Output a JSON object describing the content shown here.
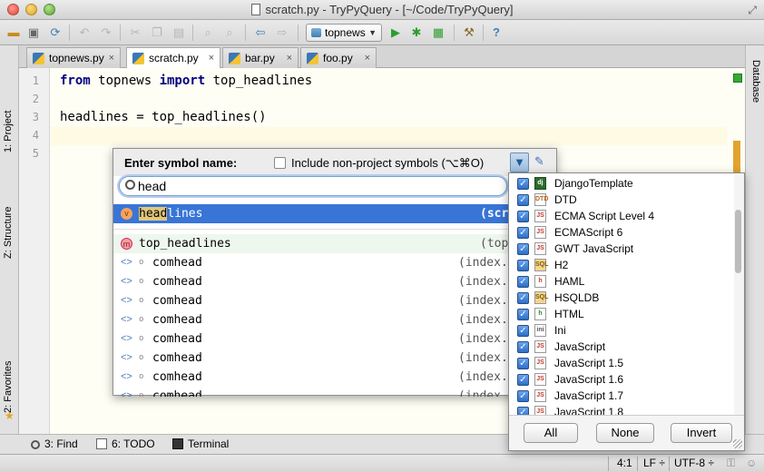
{
  "window": {
    "title": "scratch.py - TryPyQuery - [~/Code/TryPyQuery]"
  },
  "toolbar": {
    "run_config": "topnews"
  },
  "tool_stripes": {
    "project": "1: Project",
    "structure": "Z: Structure",
    "favorites": "2: Favorites",
    "database": "Database"
  },
  "tabs": [
    {
      "label": "topnews.py",
      "close": "×"
    },
    {
      "label": "scratch.py",
      "close": "×"
    },
    {
      "label": "bar.py",
      "close": "×"
    },
    {
      "label": "foo.py",
      "close": "×"
    }
  ],
  "editor": {
    "line_numbers": [
      "1",
      "2",
      "3",
      "4",
      "5"
    ],
    "line1": {
      "kw1": "from",
      "mod": " topnews ",
      "kw2": "import",
      "name": " top_headlines"
    },
    "line3": "headlines = top_headlines()"
  },
  "popup": {
    "label": "Enter symbol name:",
    "include_label": "Include non-project symbols (⌥⌘O)",
    "search_value": "head",
    "results": [
      {
        "icon": "v",
        "match": "head",
        "rest": "lines",
        "location": "(scra"
      },
      {
        "icon": "m",
        "name": "top_headlines",
        "location": "(topn"
      },
      {
        "icon": "<>",
        "name": "comhead",
        "location": "(index.h"
      },
      {
        "icon": "<>",
        "name": "comhead",
        "location": "(index.h"
      },
      {
        "icon": "<>",
        "name": "comhead",
        "location": "(index.h"
      },
      {
        "icon": "<>",
        "name": "comhead",
        "location": "(index.h"
      },
      {
        "icon": "<>",
        "name": "comhead",
        "location": "(index.h"
      },
      {
        "icon": "<>",
        "name": "comhead",
        "location": "(index.h"
      },
      {
        "icon": "<>",
        "name": "comhead",
        "location": "(index.h"
      },
      {
        "icon": "<>",
        "name": "comhead",
        "location": "(index.h"
      }
    ]
  },
  "filter_panel": {
    "file_types": [
      {
        "label": "DjangoTemplate",
        "icon": "dj",
        "checked": true
      },
      {
        "label": "DTD",
        "icon": "DTD",
        "checked": true
      },
      {
        "label": "ECMA Script Level 4",
        "icon": "JS",
        "checked": true
      },
      {
        "label": "ECMAScript 6",
        "icon": "JS",
        "checked": true
      },
      {
        "label": "GWT JavaScript",
        "icon": "JS",
        "checked": true
      },
      {
        "label": "H2",
        "icon": "SQL",
        "checked": true
      },
      {
        "label": "HAML",
        "icon": "h",
        "checked": true
      },
      {
        "label": "HSQLDB",
        "icon": "SQL",
        "checked": true
      },
      {
        "label": "HTML",
        "icon": "h",
        "checked": true
      },
      {
        "label": "Ini",
        "icon": "ini",
        "checked": true
      },
      {
        "label": "JavaScript",
        "icon": "JS",
        "checked": true
      },
      {
        "label": "JavaScript 1.5",
        "icon": "JS",
        "checked": true
      },
      {
        "label": "JavaScript 1.6",
        "icon": "JS",
        "checked": true
      },
      {
        "label": "JavaScript 1.7",
        "icon": "JS",
        "checked": true
      },
      {
        "label": "JavaScript 1.8",
        "icon": "JS",
        "checked": true
      }
    ],
    "buttons": {
      "all": "All",
      "none": "None",
      "invert": "Invert"
    }
  },
  "bottom_bar": {
    "find": "3: Find",
    "todo": "6: TODO",
    "terminal": "Terminal"
  },
  "status_bar": {
    "position": "4:1",
    "line_sep": "LF ÷",
    "encoding": "UTF-8 ÷"
  },
  "colors": {
    "selection": "#3875d7",
    "keyword": "#000080",
    "match_highlight": "#f6e08a"
  }
}
